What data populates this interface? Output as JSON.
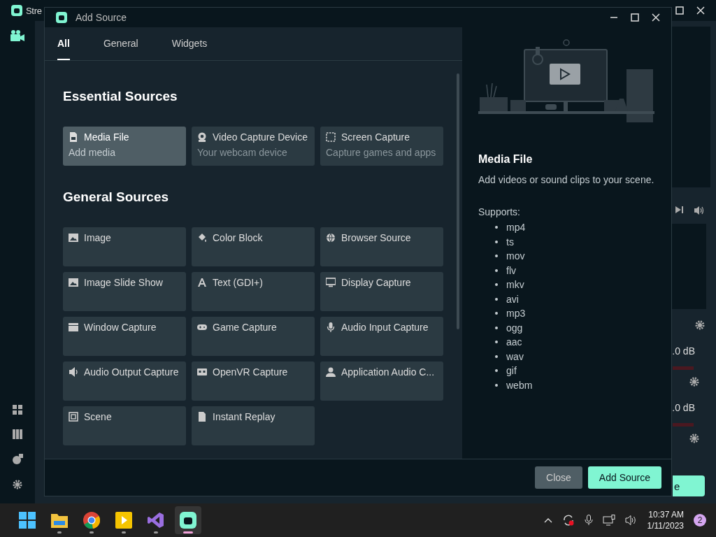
{
  "background_app": {
    "title": "Stre",
    "readings": [
      ".0 dB",
      ".0 dB"
    ],
    "button_fragment": "e"
  },
  "dialog": {
    "title": "Add Source",
    "tabs": [
      {
        "label": "All",
        "selected": true
      },
      {
        "label": "General",
        "selected": false
      },
      {
        "label": "Widgets",
        "selected": false
      }
    ],
    "sections": [
      {
        "heading": "Essential Sources",
        "items": [
          {
            "label": "Media File",
            "description": "Add media",
            "kind": "file",
            "selected": true
          },
          {
            "label": "Video Capture Device",
            "description": "Your webcam device",
            "kind": "webcam",
            "selected": false
          },
          {
            "label": "Screen Capture",
            "description": "Capture games and apps",
            "kind": "region",
            "selected": false
          }
        ]
      },
      {
        "heading": "General Sources",
        "items": [
          {
            "label": "Image",
            "kind": "image",
            "selected": false
          },
          {
            "label": "Color Block",
            "kind": "fill",
            "selected": false
          },
          {
            "label": "Browser Source",
            "kind": "globe",
            "selected": false
          },
          {
            "label": "Image Slide Show",
            "kind": "image",
            "selected": false
          },
          {
            "label": "Text (GDI+)",
            "kind": "text",
            "selected": false
          },
          {
            "label": "Display Capture",
            "kind": "monitor",
            "selected": false
          },
          {
            "label": "Window Capture",
            "kind": "window",
            "selected": false
          },
          {
            "label": "Game Capture",
            "kind": "gamepad",
            "selected": false
          },
          {
            "label": "Audio Input Capture",
            "kind": "mic",
            "selected": false
          },
          {
            "label": "Audio Output Capture",
            "kind": "speaker",
            "selected": false
          },
          {
            "label": "OpenVR Capture",
            "kind": "vr",
            "selected": false
          },
          {
            "label": "Application Audio C...",
            "kind": "user",
            "selected": false
          },
          {
            "label": "Scene",
            "kind": "scene",
            "selected": false
          },
          {
            "label": "Instant Replay",
            "kind": "document",
            "selected": false
          }
        ]
      }
    ],
    "detail": {
      "title": "Media File",
      "description": "Add videos or sound clips to your scene.",
      "supports_label": "Supports:",
      "formats": [
        "mp4",
        "ts",
        "mov",
        "flv",
        "mkv",
        "avi",
        "mp3",
        "ogg",
        "aac",
        "wav",
        "gif",
        "webm"
      ]
    },
    "buttons": [
      {
        "label": "Close",
        "kind": "secondary"
      },
      {
        "label": "Add Source",
        "kind": "primary"
      }
    ]
  },
  "taskbar": {
    "apps": [
      {
        "kind": "start",
        "selected": false
      },
      {
        "kind": "folder",
        "selected": false
      },
      {
        "kind": "browser",
        "selected": false
      },
      {
        "kind": "player",
        "selected": false
      },
      {
        "kind": "ide",
        "selected": false
      },
      {
        "kind": "streamlabs",
        "selected": true
      }
    ],
    "time": "10:37 AM",
    "date": "1/11/2023",
    "notification_count": "2"
  }
}
